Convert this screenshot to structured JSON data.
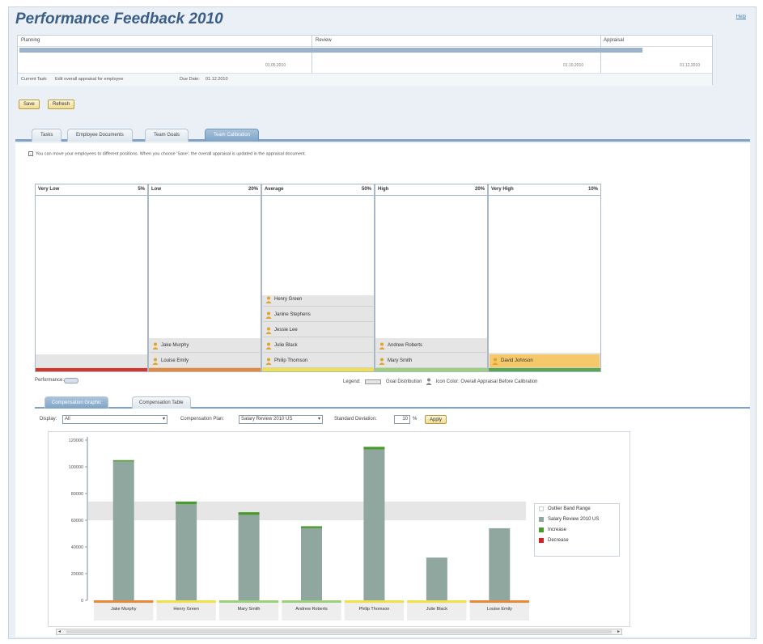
{
  "app": {
    "title": "Performance Feedback 2010",
    "help": "Help"
  },
  "roadmap": {
    "steps": [
      {
        "label": "Planning",
        "date": "01.05.2010"
      },
      {
        "label": "Review",
        "date": "01.10.2010"
      },
      {
        "label": "Appraisal",
        "date": "01.12.2010"
      }
    ],
    "progress": 0.9,
    "current_task_label": "Current Task:",
    "current_task": "Edit overall appraisal for employee",
    "due_label": "Due Date:",
    "due_date": "01.12.2010"
  },
  "toolbar": {
    "save": "Save",
    "refresh": "Refresh"
  },
  "tabs": [
    "Tasks",
    "Employee Documents",
    "Team Goals",
    "Team Calibration"
  ],
  "info_text": "You can move your employees to different positions. When you choose 'Save', the overall appraisal is updated in the appraisal document.",
  "buckets": [
    {
      "name": "Very Low",
      "pct": "5%",
      "bar_color": "#d9332b",
      "goal": 0.08,
      "employees": []
    },
    {
      "name": "Low",
      "pct": "20%",
      "bar_color": "#e8893a",
      "goal": 0.17,
      "employees": [
        "Jake Murphy",
        "Louise Emily"
      ]
    },
    {
      "name": "Average",
      "pct": "50%",
      "bar_color": "#f0e04a",
      "goal": 0.42,
      "employees": [
        "Henry Green",
        "Janine Stephens",
        "Jessie Lee",
        "Julie Black",
        "Philip Thomson"
      ]
    },
    {
      "name": "High",
      "pct": "20%",
      "bar_color": "#9cd07a",
      "goal": 0.17,
      "employees": [
        "Andrew Roberts",
        "Mary Smith"
      ]
    },
    {
      "name": "Very High",
      "pct": "10%",
      "bar_color": "#5aa84a",
      "goal": 0.09,
      "employees": [
        "David Johnson"
      ]
    }
  ],
  "performance_label": "Performance:",
  "legend": {
    "label": "Legend:",
    "goal": "Goal Distribution",
    "icon": "Icon Color: Overall Appraisal Before Calibration"
  },
  "comp_tabs": [
    "Compensation Graphic",
    "Compensation Table"
  ],
  "filters": {
    "display_label": "Display:",
    "display_value": "All",
    "plan_label": "Compensation Plan:",
    "plan_value": "Salary Review 2010 US",
    "stddev_label": "Standard Deviation:",
    "stddev_value": "10",
    "stddev_unit": "%",
    "apply": "Apply"
  },
  "chart_data": {
    "type": "bar",
    "categories": [
      "Jake Murphy",
      "Henry Green",
      "Mary Smith",
      "Andrew Roberts",
      "Philip Thomson",
      "Julie Black",
      "Louise Emily"
    ],
    "series": [
      {
        "name": "Salary Review 2010 US",
        "color": "#8fa79f",
        "values": [
          104000,
          72000,
          64000,
          54000,
          113000,
          32000,
          54000
        ]
      },
      {
        "name": "Increase",
        "color": "#4b9a2f",
        "values": [
          1000,
          2000,
          2000,
          1500,
          2000,
          0,
          0
        ]
      },
      {
        "name": "Decrease",
        "color": "#d32020",
        "values": [
          0,
          0,
          0,
          0,
          0,
          0,
          0
        ]
      }
    ],
    "category_colors": [
      "#e8893a",
      "#f0e04a",
      "#9cd07a",
      "#9cd07a",
      "#f0e04a",
      "#f0e04a",
      "#e8893a"
    ],
    "outlier_band": [
      60000,
      74000
    ],
    "ylim": [
      0,
      120000
    ],
    "yticks": [
      "0",
      "20000",
      "40000",
      "60000",
      "80000",
      "100000",
      "120000"
    ],
    "legend": [
      "Outlier Band Range",
      "Salary Review 2010 US",
      "Increase",
      "Decrease"
    ],
    "xlabel": "",
    "ylabel": ""
  }
}
